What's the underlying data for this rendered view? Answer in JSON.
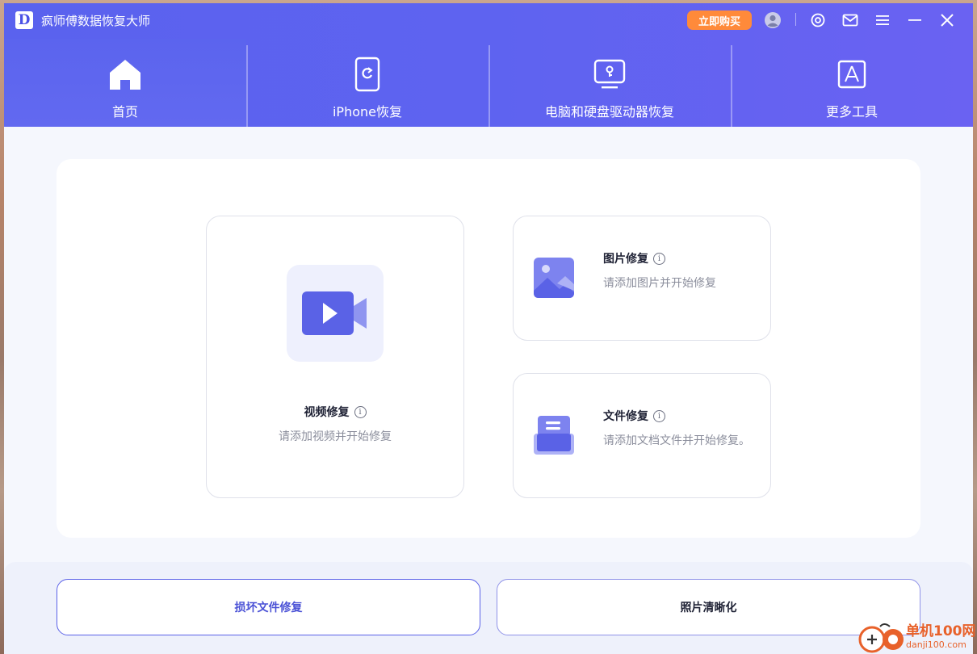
{
  "app": {
    "logo_letter": "D",
    "title": "疯师傅数据恢复大师",
    "buy_label": "立即购买"
  },
  "titlebar_icons": [
    "user-icon",
    "settings-icon",
    "mail-icon",
    "menu-icon",
    "minimize-icon",
    "close-icon"
  ],
  "nav": {
    "tabs": [
      {
        "label": "首页",
        "icon": "home-icon",
        "active": true
      },
      {
        "label": "iPhone恢复",
        "icon": "iphone-icon",
        "active": false
      },
      {
        "label": "电脑和硬盘驱动器恢复",
        "icon": "computer-drive-icon",
        "active": false
      },
      {
        "label": "更多工具",
        "icon": "tools-icon",
        "active": false
      }
    ]
  },
  "features": {
    "video": {
      "title": "视频修复",
      "desc": "请添加视频并开始修复",
      "info": "i"
    },
    "photo": {
      "title": "图片修复",
      "desc": "请添加图片并开始修复",
      "info": "i"
    },
    "file": {
      "title": "文件修复",
      "desc": "请添加文档文件并开始修复。",
      "info": "i"
    }
  },
  "bottom": {
    "damaged_label": "损坏文件修复",
    "sharpen_label": "照片清晰化"
  },
  "watermark": {
    "cn": "单机100网",
    "en": "danji100.com"
  },
  "colors": {
    "header": "#5a62ee",
    "buy_button": "#ff8a3a",
    "accent": "#5b62e8",
    "watermark": "#e8612a"
  }
}
